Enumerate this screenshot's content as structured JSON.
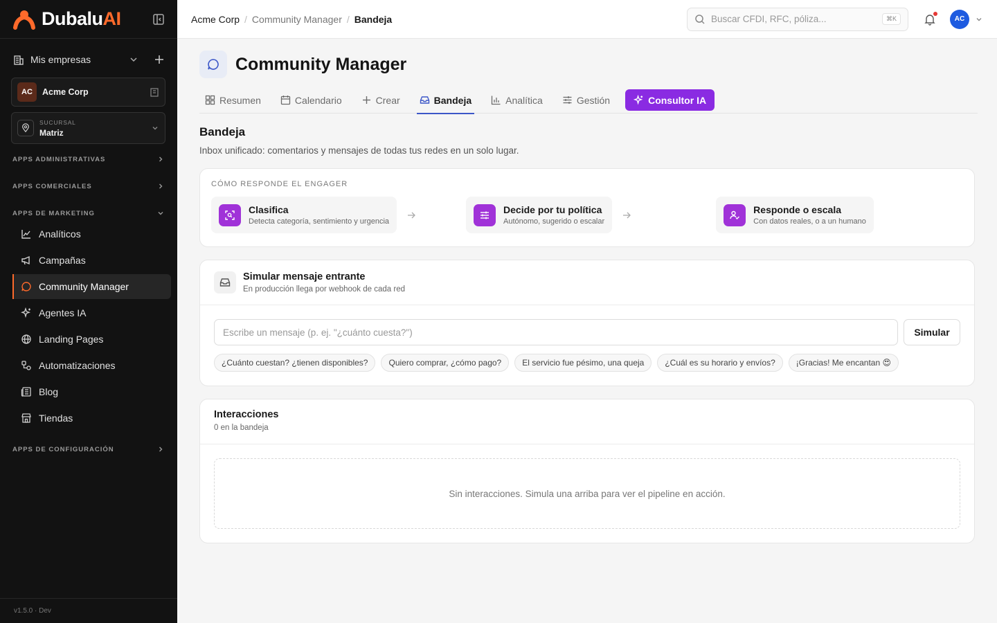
{
  "brand": {
    "name_main": "Dubalu",
    "name_accent": "AI",
    "accent_color": "#ff6a2b"
  },
  "sidebar": {
    "companies_label": "Mis empresas",
    "company": {
      "initials": "AC",
      "name": "Acme Corp"
    },
    "branch": {
      "label": "SUCURSAL",
      "value": "Matriz"
    },
    "sections": {
      "admin": "APPS ADMINISTRATIVAS",
      "commercial": "APPS COMERCIALES",
      "marketing": "APPS DE MARKETING",
      "config": "APPS DE CONFIGURACIÓN"
    },
    "items": [
      {
        "label": "Analíticos",
        "icon": "line-chart-icon"
      },
      {
        "label": "Campañas",
        "icon": "megaphone-icon"
      },
      {
        "label": "Community Manager",
        "icon": "chat-bubble-icon",
        "active": true
      },
      {
        "label": "Agentes IA",
        "icon": "sparkles-icon"
      },
      {
        "label": "Landing Pages",
        "icon": "globe-icon"
      },
      {
        "label": "Automatizaciones",
        "icon": "workflow-icon"
      },
      {
        "label": "Blog",
        "icon": "newspaper-icon"
      },
      {
        "label": "Tiendas",
        "icon": "store-icon"
      }
    ],
    "version": "v1.5.0 · Dev"
  },
  "topbar": {
    "breadcrumb": [
      "Acme Corp",
      "Community Manager",
      "Bandeja"
    ],
    "search_placeholder": "Buscar CFDI, RFC, póliza...",
    "search_shortcut": "⌘K",
    "user_initials": "AC"
  },
  "page": {
    "title": "Community Manager",
    "tabs": [
      {
        "label": "Resumen",
        "icon": "grid-icon"
      },
      {
        "label": "Calendario",
        "icon": "calendar-icon"
      },
      {
        "label": "Crear",
        "icon": "plus-icon"
      },
      {
        "label": "Bandeja",
        "icon": "inbox-icon",
        "active": true
      },
      {
        "label": "Analítica",
        "icon": "bar-chart-icon"
      },
      {
        "label": "Gestión",
        "icon": "sliders-icon"
      }
    ],
    "cta_tab": "Consultor IA",
    "section_title": "Bandeja",
    "section_desc": "Inbox unificado: comentarios y mensajes de todas tus redes en un solo lugar."
  },
  "engager": {
    "label": "CÓMO RESPONDE EL ENGAGER",
    "steps": [
      {
        "title": "Clasifica",
        "sub": "Detecta categoría, sentimiento y urgencia"
      },
      {
        "title": "Decide por tu política",
        "sub": "Autónomo, sugerido o escalar"
      },
      {
        "title": "Responde o escala",
        "sub": "Con datos reales, o a un humano"
      }
    ]
  },
  "simulator": {
    "title": "Simular mensaje entrante",
    "subtitle": "En producción llega por webhook de cada red",
    "input_placeholder": "Escribe un mensaje (p. ej. \"¿cuánto cuesta?\")",
    "button": "Simular",
    "chips": [
      "¿Cuánto cuestan? ¿tienen disponibles?",
      "Quiero comprar, ¿cómo pago?",
      "El servicio fue pésimo, una queja",
      "¿Cuál es su horario y envíos?",
      "¡Gracias! Me encantan 😍"
    ]
  },
  "interactions": {
    "title": "Interacciones",
    "count_text": "0 en la bandeja",
    "empty_text": "Sin interacciones. Simula una arriba para ver el pipeline en acción."
  }
}
